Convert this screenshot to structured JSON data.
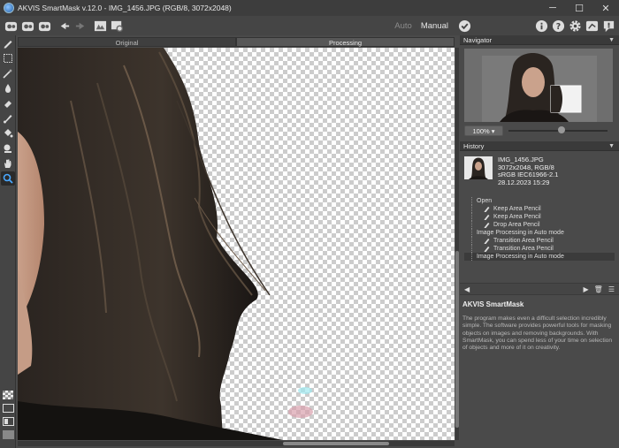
{
  "window": {
    "title": "AKVIS SmartMask v.12.0 - IMG_1456.JPG (RGB/8, 3072x2048)",
    "minimize": "─",
    "maximize": "☐",
    "close": "✕"
  },
  "toolbar": {
    "mode_auto": "Auto",
    "mode_manual": "Manual"
  },
  "canvas": {
    "tab_original": "Original",
    "tab_processing": "Processing"
  },
  "navigator": {
    "title": "Navigator",
    "zoom": "100% ▾"
  },
  "history": {
    "title": "History",
    "meta": [
      "IMG_1456.JPG",
      "3072x2048, RGB/8",
      "sRGB IEC61966-2.1",
      "28.12.2023 15:29"
    ],
    "items": [
      {
        "label": "Open",
        "sub": false
      },
      {
        "label": "Keep Area Pencil",
        "sub": true
      },
      {
        "label": "Keep Area Pencil",
        "sub": true
      },
      {
        "label": "Drop Area Pencil",
        "sub": true
      },
      {
        "label": "Image Processing in Auto mode",
        "sub": false
      },
      {
        "label": "Transition Area Pencil",
        "sub": true
      },
      {
        "label": "Transition Area Pencil",
        "sub": true
      },
      {
        "label": "Image Processing in Auto mode",
        "sub": false
      }
    ]
  },
  "about": {
    "title": "AKVIS SmartMask",
    "text": "The program makes even a difficult selection incredibly simple. The software provides powerful tools for masking objects on images and removing backgrounds. With SmartMask, you can spend less of your time on selection of objects and more of it on creativity."
  },
  "colors": {
    "panel": "#4a4a4a",
    "toolbar": "#454545",
    "titlebar": "#3d3d3d"
  }
}
